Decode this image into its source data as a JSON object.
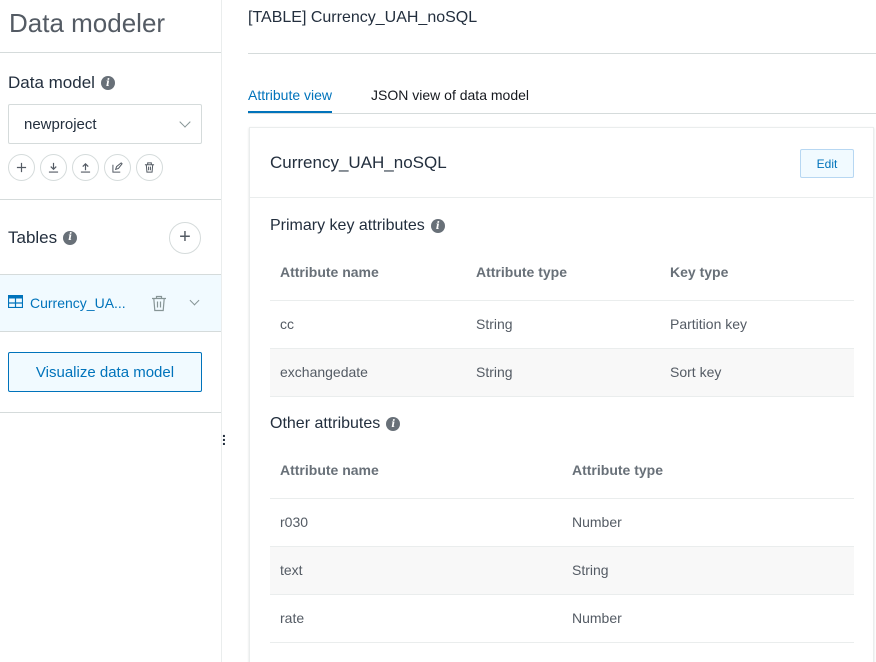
{
  "sidebar": {
    "title": "Data modeler",
    "data_model_label": "Data model",
    "data_model_value": "newproject",
    "tables_label": "Tables",
    "table_item": "Currency_UA...",
    "visualize_label": "Visualize data model"
  },
  "main": {
    "page_title": "[TABLE] Currency_UAH_noSQL",
    "tabs": [
      {
        "label": "Attribute view",
        "active": true
      },
      {
        "label": "JSON view of data model",
        "active": false
      }
    ],
    "card_title": "Currency_UAH_noSQL",
    "edit_label": "Edit",
    "primary_section": "Primary key attributes",
    "primary_headers": [
      "Attribute name",
      "Attribute type",
      "Key type"
    ],
    "primary_rows": [
      [
        "cc",
        "String",
        "Partition key"
      ],
      [
        "exchangedate",
        "String",
        "Sort key"
      ]
    ],
    "other_section": "Other attributes",
    "other_headers": [
      "Attribute name",
      "Attribute type"
    ],
    "other_rows": [
      [
        "r030",
        "Number"
      ],
      [
        "text",
        "String"
      ],
      [
        "rate",
        "Number"
      ]
    ]
  },
  "colors": {
    "accent": "#0073bb",
    "selected_bg": "#f1faff",
    "border": "#d5dbdb"
  },
  "icons": [
    "info-icon",
    "plus-icon",
    "download-icon",
    "upload-icon",
    "edit-icon",
    "trash-icon",
    "table-icon",
    "chevron-down-icon",
    "drag-handle-icon"
  ]
}
